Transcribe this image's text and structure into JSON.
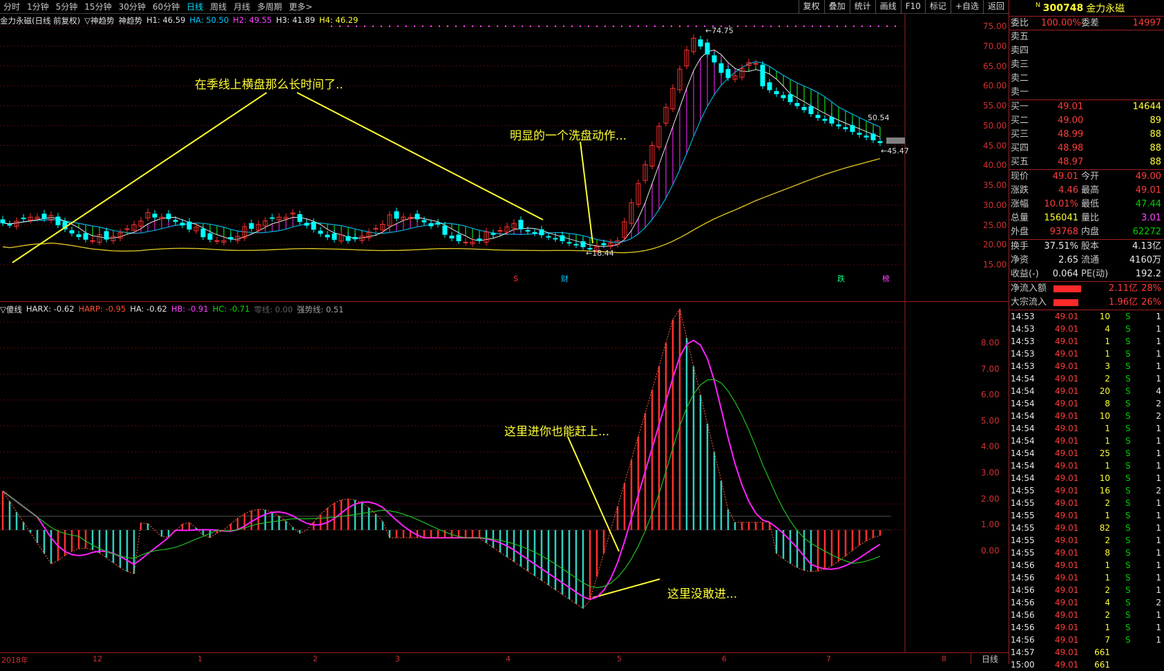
{
  "toolbar": {
    "tabs": [
      "分时",
      "1分钟",
      "5分钟",
      "15分钟",
      "30分钟",
      "60分钟",
      "日线",
      "周线",
      "月线",
      "多周期",
      "更多>"
    ],
    "active": "日线",
    "right": [
      "复权",
      "叠加",
      "统计",
      "画线",
      "F10",
      "标记",
      "+自选",
      "返回"
    ]
  },
  "header": {
    "title": "金力永磁(日线 前复权)",
    "ind1": "▽神趋势",
    "ind2": "神趋势",
    "h1": "H1: 46.59",
    "ha": "HA: 50.50",
    "h2": "H2: 49.55",
    "h3": "H3: 41.89",
    "h4": "H4: 46.29"
  },
  "subheader": {
    "name": "▽傻线",
    "harx": "HARX: -0.62",
    "harp": "HARP: -0.95",
    "ha": "HA: -0.62",
    "hb": "HB: -0.91",
    "hc": "HC: -0.71",
    "zero": "零线: 0.00",
    "strong": "强势线: 0.51"
  },
  "annotations": {
    "a1": "在季线上横盘那么长时间了..",
    "a2": "明显的一个洗盘动作...",
    "a3": "这里进你也能赶上...",
    "a4": "这里没敢进..."
  },
  "markers": {
    "s": "S",
    "cai": "财",
    "die": "跌",
    "bang": "榜"
  },
  "price_labels": {
    "high": "74.75",
    "low": "18.44",
    "p1": "50.54",
    "p2": "45.47"
  },
  "axis_top": [
    "75.00",
    "70.00",
    "65.00",
    "60.00",
    "55.00",
    "50.00",
    "45.00",
    "40.00",
    "35.00",
    "30.00",
    "25.00",
    "20.00",
    "15.00"
  ],
  "axis_bot": [
    "8.00",
    "7.00",
    "6.00",
    "5.00",
    "4.00",
    "3.00",
    "2.00",
    "1.00",
    "0.00"
  ],
  "x_labels": [
    "2018年",
    "12",
    "1",
    "2",
    "3",
    "4",
    "5",
    "6",
    "7",
    "8"
  ],
  "period_label": "日线",
  "quote": {
    "code": "300748",
    "name": "金力永磁",
    "n": "N",
    "webi_l": "委比",
    "webi": "100.00%",
    "wecha_l": "委差",
    "wecha": "14997",
    "sells": [
      "卖五",
      "卖四",
      "卖三",
      "卖二",
      "卖一"
    ],
    "buys": [
      {
        "l": "买一",
        "p": "49.01",
        "v": "14644"
      },
      {
        "l": "买二",
        "p": "49.00",
        "v": "89"
      },
      {
        "l": "买三",
        "p": "48.99",
        "v": "88"
      },
      {
        "l": "买四",
        "p": "48.98",
        "v": "88"
      },
      {
        "l": "买五",
        "p": "48.97",
        "v": "88"
      }
    ],
    "stats": [
      {
        "a": "现价",
        "av": "49.01",
        "b": "今开",
        "bv": "49.00"
      },
      {
        "a": "涨跌",
        "av": "4.46",
        "b": "最高",
        "bv": "49.01"
      },
      {
        "a": "涨幅",
        "av": "10.01%",
        "b": "最低",
        "bv": "47.44"
      },
      {
        "a": "总量",
        "av": "156041",
        "b": "量比",
        "bv": "3.01"
      },
      {
        "a": "外盘",
        "av": "93768",
        "b": "内盘",
        "bv": "62272"
      }
    ],
    "stats2": [
      {
        "a": "换手",
        "av": "37.51%",
        "b": "股本",
        "bv": "4.13亿"
      },
      {
        "a": "净资",
        "av": "2.65",
        "b": "流通",
        "bv": "4160万"
      },
      {
        "a": "收益(-)",
        "av": "0.064",
        "b": "PE(动)",
        "bv": "192.2"
      }
    ],
    "flow": [
      {
        "l": "净流入额",
        "v": "2.11亿",
        "p": "28%"
      },
      {
        "l": "大宗流入",
        "v": "1.96亿",
        "p": "26%"
      }
    ]
  },
  "ticks": [
    [
      "14:53",
      "49.01",
      "10",
      "S",
      "1"
    ],
    [
      "14:53",
      "49.01",
      "4",
      "S",
      "1"
    ],
    [
      "14:53",
      "49.01",
      "1",
      "S",
      "1"
    ],
    [
      "14:53",
      "49.01",
      "1",
      "S",
      "1"
    ],
    [
      "14:53",
      "49.01",
      "3",
      "S",
      "1"
    ],
    [
      "14:54",
      "49.01",
      "2",
      "S",
      "1"
    ],
    [
      "14:54",
      "49.01",
      "20",
      "S",
      "4"
    ],
    [
      "14:54",
      "49.01",
      "8",
      "S",
      "2"
    ],
    [
      "14:54",
      "49.01",
      "10",
      "S",
      "2"
    ],
    [
      "14:54",
      "49.01",
      "1",
      "S",
      "1"
    ],
    [
      "14:54",
      "49.01",
      "1",
      "S",
      "1"
    ],
    [
      "14:54",
      "49.01",
      "25",
      "S",
      "1"
    ],
    [
      "14:54",
      "49.01",
      "1",
      "S",
      "1"
    ],
    [
      "14:54",
      "49.01",
      "10",
      "S",
      "1"
    ],
    [
      "14:55",
      "49.01",
      "16",
      "S",
      "2"
    ],
    [
      "14:55",
      "49.01",
      "2",
      "S",
      "1"
    ],
    [
      "14:55",
      "49.01",
      "1",
      "S",
      "1"
    ],
    [
      "14:55",
      "49.01",
      "82",
      "S",
      "1"
    ],
    [
      "14:55",
      "49.01",
      "2",
      "S",
      "1"
    ],
    [
      "14:55",
      "49.01",
      "8",
      "S",
      "1"
    ],
    [
      "14:56",
      "49.01",
      "1",
      "S",
      "1"
    ],
    [
      "14:56",
      "49.01",
      "1",
      "S",
      "1"
    ],
    [
      "14:56",
      "49.01",
      "2",
      "S",
      "1"
    ],
    [
      "14:56",
      "49.01",
      "4",
      "S",
      "2"
    ],
    [
      "14:56",
      "49.01",
      "2",
      "S",
      "1"
    ],
    [
      "14:56",
      "49.01",
      "1",
      "S",
      "1"
    ],
    [
      "14:56",
      "49.01",
      "7",
      "S",
      "1"
    ],
    [
      "14:57",
      "49.01",
      "661",
      "",
      " "
    ],
    [
      "15:00",
      "49.01",
      "661",
      "",
      ""
    ]
  ]
}
